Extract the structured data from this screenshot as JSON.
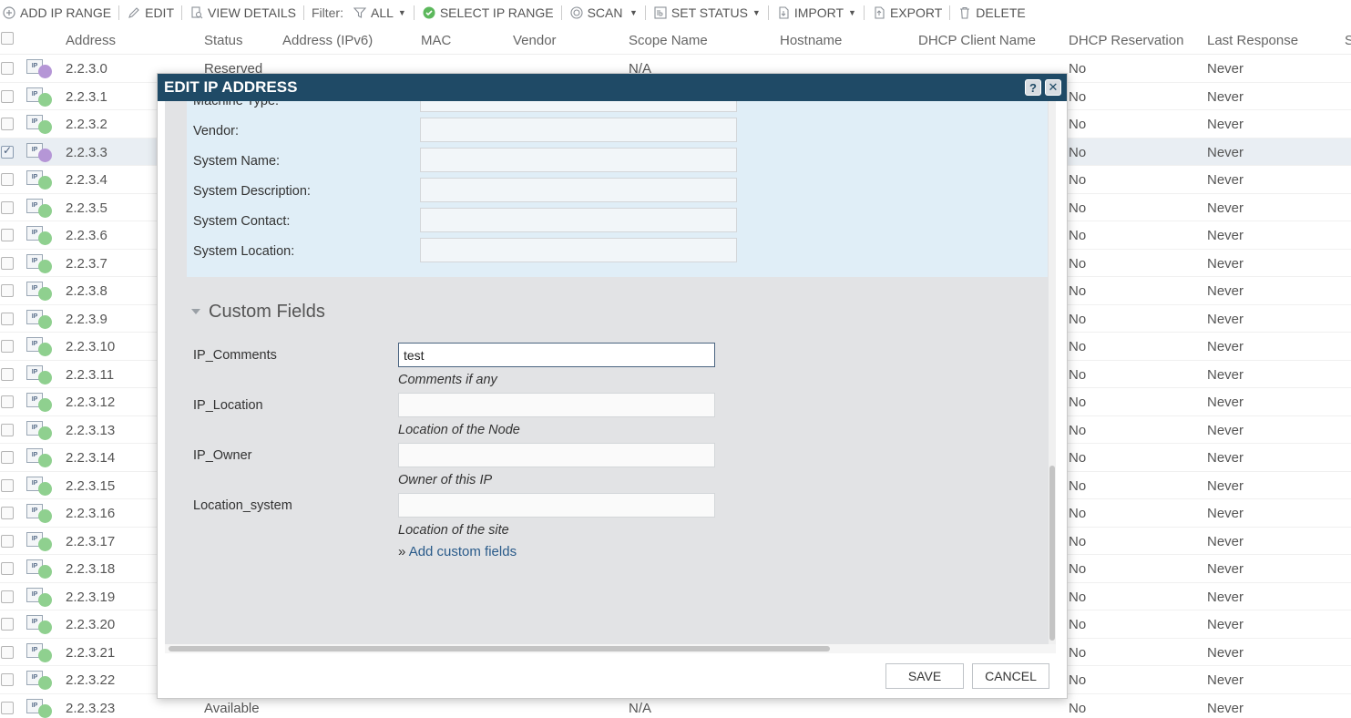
{
  "toolbar": {
    "add_ip_range": "ADD IP RANGE",
    "edit": "EDIT",
    "view_details": "VIEW DETAILS",
    "filter_label": "Filter:",
    "filter_all": "ALL",
    "select_ip_range": "SELECT IP RANGE",
    "scan": "SCAN",
    "set_status": "SET STATUS",
    "import": "IMPORT",
    "export": "EXPORT",
    "delete": "DELETE"
  },
  "grid": {
    "columns": [
      "Address",
      "Status",
      "Address (IPv6)",
      "MAC",
      "Vendor",
      "Scope Name",
      "Hostname",
      "DHCP Client Name",
      "DHCP Reservation",
      "Last Response",
      "S"
    ],
    "rows": [
      {
        "address": "2.2.3.0",
        "status": "Reserved",
        "scope": "N/A",
        "dhcp_res": "No",
        "last": "Never",
        "dot": "purple",
        "checked": false
      },
      {
        "address": "2.2.3.1",
        "status": "",
        "scope": "",
        "dhcp_res": "No",
        "last": "Never",
        "dot": "green",
        "checked": false
      },
      {
        "address": "2.2.3.2",
        "status": "",
        "scope": "",
        "dhcp_res": "No",
        "last": "Never",
        "dot": "green",
        "checked": false
      },
      {
        "address": "2.2.3.3",
        "status": "",
        "scope": "",
        "dhcp_res": "No",
        "last": "Never",
        "dot": "purple",
        "checked": true
      },
      {
        "address": "2.2.3.4",
        "status": "",
        "scope": "",
        "dhcp_res": "No",
        "last": "Never",
        "dot": "green",
        "checked": false
      },
      {
        "address": "2.2.3.5",
        "status": "",
        "scope": "",
        "dhcp_res": "No",
        "last": "Never",
        "dot": "green",
        "checked": false
      },
      {
        "address": "2.2.3.6",
        "status": "",
        "scope": "",
        "dhcp_res": "No",
        "last": "Never",
        "dot": "green",
        "checked": false
      },
      {
        "address": "2.2.3.7",
        "status": "",
        "scope": "",
        "dhcp_res": "No",
        "last": "Never",
        "dot": "green",
        "checked": false
      },
      {
        "address": "2.2.3.8",
        "status": "",
        "scope": "",
        "dhcp_res": "No",
        "last": "Never",
        "dot": "green",
        "checked": false
      },
      {
        "address": "2.2.3.9",
        "status": "",
        "scope": "",
        "dhcp_res": "No",
        "last": "Never",
        "dot": "green",
        "checked": false
      },
      {
        "address": "2.2.3.10",
        "status": "",
        "scope": "",
        "dhcp_res": "No",
        "last": "Never",
        "dot": "green",
        "checked": false
      },
      {
        "address": "2.2.3.11",
        "status": "",
        "scope": "",
        "dhcp_res": "No",
        "last": "Never",
        "dot": "green",
        "checked": false
      },
      {
        "address": "2.2.3.12",
        "status": "",
        "scope": "",
        "dhcp_res": "No",
        "last": "Never",
        "dot": "green",
        "checked": false
      },
      {
        "address": "2.2.3.13",
        "status": "",
        "scope": "",
        "dhcp_res": "No",
        "last": "Never",
        "dot": "green",
        "checked": false
      },
      {
        "address": "2.2.3.14",
        "status": "",
        "scope": "",
        "dhcp_res": "No",
        "last": "Never",
        "dot": "green",
        "checked": false
      },
      {
        "address": "2.2.3.15",
        "status": "",
        "scope": "",
        "dhcp_res": "No",
        "last": "Never",
        "dot": "green",
        "checked": false
      },
      {
        "address": "2.2.3.16",
        "status": "",
        "scope": "",
        "dhcp_res": "No",
        "last": "Never",
        "dot": "green",
        "checked": false
      },
      {
        "address": "2.2.3.17",
        "status": "",
        "scope": "",
        "dhcp_res": "No",
        "last": "Never",
        "dot": "green",
        "checked": false
      },
      {
        "address": "2.2.3.18",
        "status": "",
        "scope": "",
        "dhcp_res": "No",
        "last": "Never",
        "dot": "green",
        "checked": false
      },
      {
        "address": "2.2.3.19",
        "status": "",
        "scope": "",
        "dhcp_res": "No",
        "last": "Never",
        "dot": "green",
        "checked": false
      },
      {
        "address": "2.2.3.20",
        "status": "",
        "scope": "",
        "dhcp_res": "No",
        "last": "Never",
        "dot": "green",
        "checked": false
      },
      {
        "address": "2.2.3.21",
        "status": "",
        "scope": "",
        "dhcp_res": "No",
        "last": "Never",
        "dot": "green",
        "checked": false
      },
      {
        "address": "2.2.3.22",
        "status": "",
        "scope": "",
        "dhcp_res": "No",
        "last": "Never",
        "dot": "green",
        "checked": false
      },
      {
        "address": "2.2.3.23",
        "status": "Available",
        "scope": "N/A",
        "dhcp_res": "No",
        "last": "Never",
        "dot": "green",
        "checked": false
      }
    ]
  },
  "modal": {
    "title": "EDIT IP ADDRESS",
    "help": "?",
    "close": "✕",
    "fields": [
      {
        "label": "Machine Type:",
        "value": ""
      },
      {
        "label": "Vendor:",
        "value": ""
      },
      {
        "label": "System Name:",
        "value": ""
      },
      {
        "label": "System Description:",
        "value": ""
      },
      {
        "label": "System Contact:",
        "value": ""
      },
      {
        "label": "System Location:",
        "value": ""
      }
    ],
    "custom_section_title": "Custom Fields",
    "custom_fields": [
      {
        "label": "IP_Comments",
        "value": "test",
        "hint": "Comments if any"
      },
      {
        "label": "IP_Location",
        "value": "",
        "hint": "Location of the Node"
      },
      {
        "label": "IP_Owner",
        "value": "",
        "hint": "Owner of this IP"
      },
      {
        "label": "Location_system",
        "value": "",
        "hint": "Location of the site"
      }
    ],
    "add_link_prefix": "»",
    "add_link": "Add custom fields",
    "save": "SAVE",
    "cancel": "CANCEL"
  }
}
